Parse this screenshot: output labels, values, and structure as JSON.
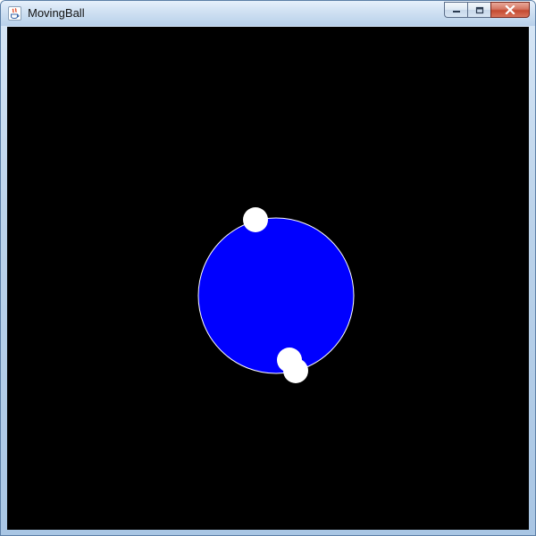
{
  "window": {
    "title": "MovingBall",
    "app_icon": "java-icon",
    "controls": {
      "minimize_icon": "minimize-icon",
      "maximize_icon": "maximize-icon",
      "close_icon": "close-icon"
    }
  },
  "canvas": {
    "background_color": "#000000",
    "big_ball_color": "#0000ff",
    "big_ball_outline_color": "#ffffff",
    "small_ball_color": "#ffffff"
  }
}
